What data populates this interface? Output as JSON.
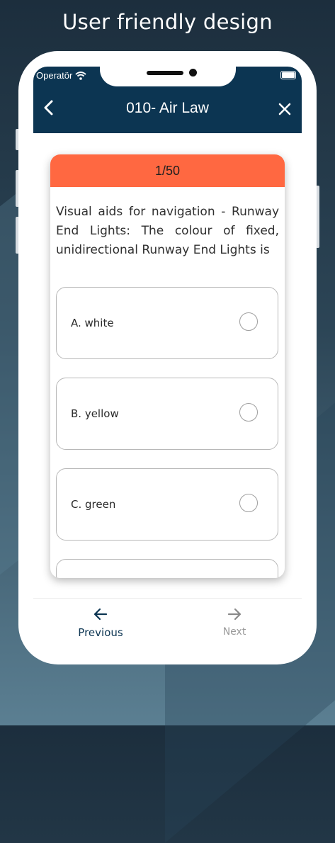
{
  "promo": {
    "title": "User friendly design"
  },
  "status_bar": {
    "carrier": "Operatör",
    "icons": [
      "wifi-icon",
      "battery-icon"
    ]
  },
  "header": {
    "title": "010- Air Law",
    "back_icon": "chevron-left-icon",
    "close_icon": "close-icon"
  },
  "colors": {
    "header_bg": "#0c3552",
    "card_header_bg": "#ff6841",
    "background": "#2c4556"
  },
  "quiz": {
    "progress": "1/50",
    "question": "Visual aids for navigation - Runway End Lights: The colour of fixed, unidirectional Runway End Lights is",
    "options": [
      {
        "label": "A. white",
        "selected": false
      },
      {
        "label": "B. yellow",
        "selected": false
      },
      {
        "label": "C. green",
        "selected": false
      }
    ]
  },
  "footer": {
    "previous_label": "Previous",
    "next_label": "Next",
    "previous_icon": "arrow-left-icon",
    "next_icon": "arrow-right-icon"
  }
}
